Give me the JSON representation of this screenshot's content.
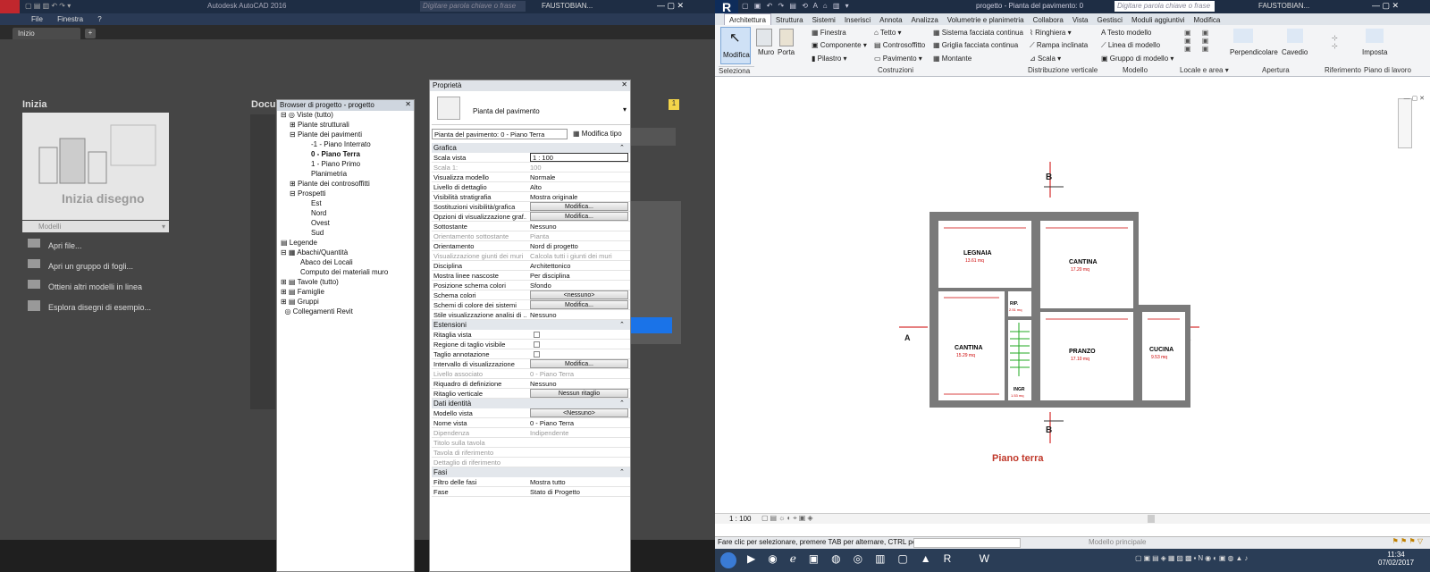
{
  "autocad": {
    "title": "Autodesk AutoCAD 2016",
    "search_placeholder": "Digitare parola chiave o frase",
    "user": "FAUSTOBIAN...",
    "menu": [
      "File",
      "Finestra",
      "?"
    ],
    "tab": "Inizio",
    "start_heading": "Inizia",
    "start_drawing": "Inizia disegno",
    "template": "Modelli",
    "links": [
      "Apri file...",
      "Apri un gruppo di fogli...",
      "Ottieni altri modelli in linea",
      "Esplora disegni di esempio..."
    ],
    "docs_heading": "Docu",
    "notification_count": "1"
  },
  "revit": {
    "title": "progetto - Pianta del pavimento: 0...",
    "search_placeholder": "Digitare parola chiave o frase",
    "user": "FAUSTOBIAN...",
    "tabs": [
      "Architettura",
      "Struttura",
      "Sistemi",
      "Inserisci",
      "Annota",
      "Analizza",
      "Volumetrie e planimetria",
      "Collabora",
      "Vista",
      "Gestisci",
      "Moduli aggiuntivi",
      "Modifica"
    ],
    "ribbon": {
      "modify": "Modifica",
      "wall": "Muro",
      "door": "Porta",
      "window": "Finestra",
      "component": "Componente",
      "column": "Pilastro",
      "roof": "Tetto",
      "ceiling": "Controsoffitto",
      "floor": "Pavimento",
      "curtain_system": "Sistema facciata continua",
      "curtain_grid": "Griglia facciata continua",
      "mullion": "Montante",
      "railing": "Ringhiera",
      "ramp": "Rampa inclinata",
      "stair": "Scala",
      "model_text": "Testo modello",
      "model_line": "Linea di modello",
      "model_group": "Gruppo di modello",
      "perpendicular": "Perpendicolare",
      "shaft": "Cavedio",
      "set": "Imposta"
    },
    "groups": [
      "Seleziona",
      "Costruzioni",
      "Distribuzione verticale",
      "Modello",
      "Locale e area",
      "Apertura",
      "Riferimento",
      "Piano di lavoro"
    ],
    "plan_title": "Piano terra",
    "rooms": [
      {
        "name": "LEGNAIA",
        "area": "13.61 mq"
      },
      {
        "name": "CANTINA",
        "area": "17.20 mq"
      },
      {
        "name": "CANTINA",
        "area": "15.29 mq"
      },
      {
        "name": "RIP.",
        "area": "2.51 mq"
      },
      {
        "name": "PRANZO",
        "area": "17.10 mq"
      },
      {
        "name": "CUCINA",
        "area": "9.53 mq"
      },
      {
        "name": "INGR",
        "area": "1.53 mq"
      }
    ],
    "section_marker": "B",
    "elevation_marker": "A",
    "scale": "1 : 100",
    "status_text": "Fare clic per selezionare, premere TAB per alternare, CTRL per",
    "model_selector": "Modello principale",
    "clock_time": "11:34",
    "clock_date": "07/02/2017"
  },
  "browser": {
    "title": "Browser di progetto - progetto",
    "items": [
      "Viste (tutto)",
      "Piante strutturali",
      "Piante dei pavimenti",
      "-1 - Piano Interrato",
      "0 - Piano Terra",
      "1 - Piano Primo",
      "Planimetria",
      "Piante dei controsoffitti",
      "Prospetti",
      "Est",
      "Nord",
      "Ovest",
      "Sud",
      "Legende",
      "Abachi/Quantità",
      "Abaco dei Locali",
      "Computo dei materiali muro",
      "Tavole (tutto)",
      "Famiglie",
      "Gruppi",
      "Collegamenti Revit"
    ]
  },
  "properties": {
    "title": "Proprietà",
    "type_name": "Pianta del pavimento",
    "selector": "Pianta del pavimento: 0 - Piano Terra",
    "edit_type": "Modifica tipo",
    "sections": {
      "graphics": "Grafica",
      "extents": "Estensioni",
      "identity": "Dati identità",
      "phases": "Fasi"
    },
    "graphics": [
      {
        "k": "Scala vista",
        "v": "1 : 100"
      },
      {
        "k": "Scala 1:",
        "v": "100"
      },
      {
        "k": "Visualizza modello",
        "v": "Normale"
      },
      {
        "k": "Livello di dettaglio",
        "v": "Alto"
      },
      {
        "k": "Visibilità stratigrafia",
        "v": "Mostra originale"
      },
      {
        "k": "Sostituzioni visibilità/grafica",
        "v": "Modifica..."
      },
      {
        "k": "Opzioni di visualizzazione graf...",
        "v": "Modifica..."
      },
      {
        "k": "Sottostante",
        "v": "Nessuno"
      },
      {
        "k": "Orientamento sottostante",
        "v": "Pianta"
      },
      {
        "k": "Orientamento",
        "v": "Nord di progetto"
      },
      {
        "k": "Visualizzazione giunti dei muri",
        "v": "Calcola tutti i giunti dei muri"
      },
      {
        "k": "Disciplina",
        "v": "Architettonico"
      },
      {
        "k": "Mostra linee nascoste",
        "v": "Per disciplina"
      },
      {
        "k": "Posizione schema colori",
        "v": "Sfondo"
      },
      {
        "k": "Schema colori",
        "v": "<nessuno>"
      },
      {
        "k": "Schemi di colore dei sistemi",
        "v": "Modifica..."
      },
      {
        "k": "Stile visualizzazione analisi di ...",
        "v": "Nessuno"
      }
    ],
    "extents": [
      {
        "k": "Ritaglia vista",
        "v": ""
      },
      {
        "k": "Regione di taglio visibile",
        "v": ""
      },
      {
        "k": "Taglio annotazione",
        "v": ""
      },
      {
        "k": "Intervallo di visualizzazione",
        "v": "Modifica..."
      },
      {
        "k": "Livello associato",
        "v": "0 - Piano Terra"
      },
      {
        "k": "Riquadro di definizione",
        "v": "Nessuno"
      },
      {
        "k": "Ritaglio verticale",
        "v": "Nessun ritaglio"
      }
    ],
    "identity": [
      {
        "k": "Modello vista",
        "v": "<Nessuno>"
      },
      {
        "k": "Nome vista",
        "v": "0 - Piano Terra"
      },
      {
        "k": "Dipendenza",
        "v": "Indipendente"
      },
      {
        "k": "Titolo sulla tavola",
        "v": ""
      },
      {
        "k": "Tavola di riferimento",
        "v": ""
      },
      {
        "k": "Dettaglio di riferimento",
        "v": ""
      }
    ],
    "phases": [
      {
        "k": "Filtro delle fasi",
        "v": "Mostra tutto"
      },
      {
        "k": "Fase",
        "v": "Stato di Progetto"
      }
    ]
  }
}
